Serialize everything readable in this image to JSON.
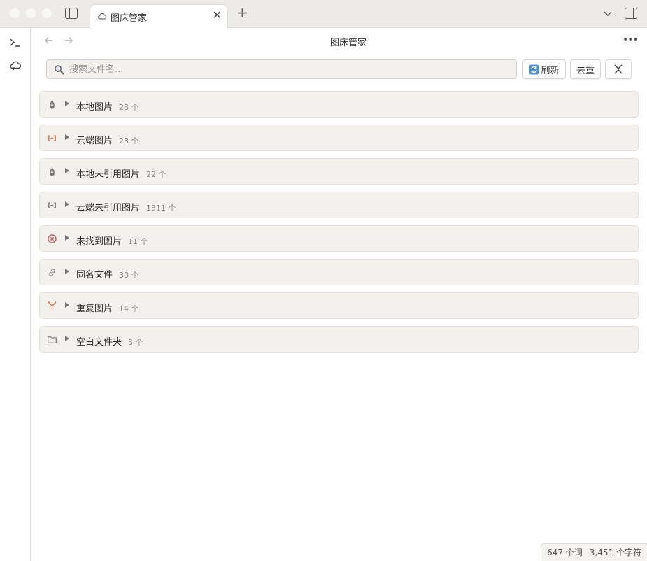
{
  "tab": {
    "title": "图床管家",
    "icon": "cloud-icon"
  },
  "header": {
    "title": "图床管家"
  },
  "toolbar": {
    "search_placeholder": "搜索文件名...",
    "search_value": "",
    "refresh_label": "刷新",
    "dedupe_label": "去重",
    "collapse_icon": "collapse-all-icon"
  },
  "ribbon": {
    "items": [
      {
        "icon": "terminal-icon"
      },
      {
        "icon": "cloud-icon"
      }
    ]
  },
  "groups": [
    {
      "label": "本地图片",
      "count": "23 个",
      "icon": "local-image-icon",
      "color": "#7a7a7a"
    },
    {
      "label": "云端图片",
      "count": "28 个",
      "icon": "cloud-link-icon",
      "color": "#e2703a"
    },
    {
      "label": "本地未引用图片",
      "count": "22 个",
      "icon": "local-image-icon",
      "color": "#7a7a7a"
    },
    {
      "label": "云端未引用图片",
      "count": "1311 个",
      "icon": "cloud-link-icon",
      "color": "#7a7a7a"
    },
    {
      "label": "未找到图片",
      "count": "11 个",
      "icon": "error-circle-icon",
      "color": "#d0524a"
    },
    {
      "label": "同名文件",
      "count": "30 个",
      "icon": "link-icon",
      "color": "#7a7a7a"
    },
    {
      "label": "重复图片",
      "count": "14 个",
      "icon": "merge-icon",
      "color": "#e2703a"
    },
    {
      "label": "空白文件夹",
      "count": "3 个",
      "icon": "folder-icon",
      "color": "#7a7a7a"
    }
  ],
  "status": {
    "words": "647 个词",
    "chars": "3,451 个字符"
  }
}
